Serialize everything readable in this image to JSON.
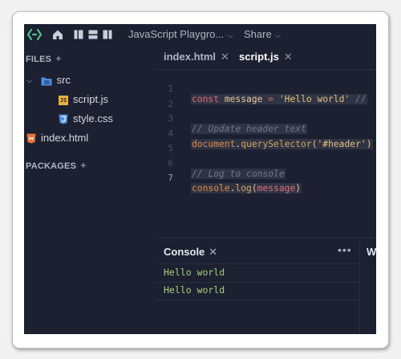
{
  "topbar": {
    "title": "JavaScript Playgro...",
    "share_label": "Share"
  },
  "sidebar": {
    "files_label": "FILES",
    "packages_label": "PACKAGES",
    "folder": "src",
    "files": [
      "script.js",
      "style.css"
    ],
    "root_file": "index.html",
    "js_badge": "JS"
  },
  "editor": {
    "tabs": [
      {
        "label": "index.html",
        "active": false
      },
      {
        "label": "script.js",
        "active": true
      }
    ],
    "line_numbers": [
      "1",
      "2",
      "3",
      "4",
      "5",
      "6",
      "7"
    ],
    "lines": {
      "l1": {
        "kw": "const",
        "var": " message",
        "op": " = ",
        "str": "'Hello world'",
        "cm": " //"
      },
      "l3": {
        "cm": "// Update header text"
      },
      "l4": {
        "obj": "document",
        "dot": ".",
        "fn": "querySelector",
        "open": "(",
        "str": "'#header'",
        "close": ")"
      },
      "l6": {
        "cm": "// Log to console"
      },
      "l7": {
        "obj": "console",
        "dot": ".",
        "fn": "log",
        "open": "(",
        "arg": "message",
        "close": ")"
      }
    }
  },
  "console": {
    "title": "Console",
    "more_icon": "ellipsis-icon",
    "outputs": [
      "Hello world",
      "Hello world"
    ]
  },
  "right_panel": {
    "label": "W"
  },
  "colors": {
    "background": "#1c2030",
    "keyword": "#e06c75",
    "function": "#d2a55c",
    "string": "#e5c07b",
    "comment": "#6f7788",
    "console_output": "#a8d07a"
  }
}
